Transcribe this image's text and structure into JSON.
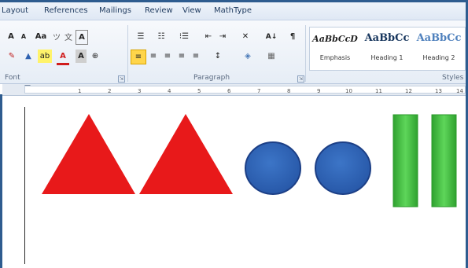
{
  "menu": [
    "Layout",
    "References",
    "Mailings",
    "Review",
    "View",
    "MathType"
  ],
  "ribbon": {
    "font_group_label": "Font",
    "paragraph_group_label": "Paragraph",
    "styles_group_label": "Styles",
    "launcher_glyph": "⇲",
    "font_tools": {
      "grow": "A",
      "shrink": "A",
      "change_case": "Aa",
      "clear_format": "A",
      "highlight": "ab",
      "font_color": "A",
      "char_shading": "A",
      "enclose": "⊕"
    },
    "paragraph_tools": {
      "bullets": "☰",
      "numbering": "☷",
      "multilevel": "⁝☰",
      "decrease_indent": "⇤",
      "increase_indent": "⇥",
      "sort": "A↓",
      "show_marks": "¶",
      "align_left": "≡",
      "center": "≡",
      "align_right": "≡",
      "justify": "≡",
      "distributed": "≡",
      "line_spacing": "↕",
      "shading": "◈",
      "borders": "▦",
      "x_icon": "✕"
    },
    "styles": [
      {
        "preview": "AaBbCcD",
        "name": "Emphasis"
      },
      {
        "preview": "AaBbCc",
        "name": "Heading 1"
      },
      {
        "preview": "AaBbCc",
        "name": "Heading 2"
      }
    ]
  },
  "ruler_numbers": [
    "1",
    "2",
    "3",
    "4",
    "5",
    "6",
    "7",
    "8",
    "9",
    "10",
    "11",
    "12",
    "13",
    "14"
  ],
  "shapes": {
    "triangle_color": "#e8191a",
    "circle_fill": "#2f62b0",
    "circle_stroke": "#1c3f86",
    "bar_color": "#3dbb3a",
    "bar_edge": "#2a9a2a"
  },
  "colors": {
    "accent_blue": "#2e5c8f",
    "highlight_yellow": "#ffd54a"
  }
}
